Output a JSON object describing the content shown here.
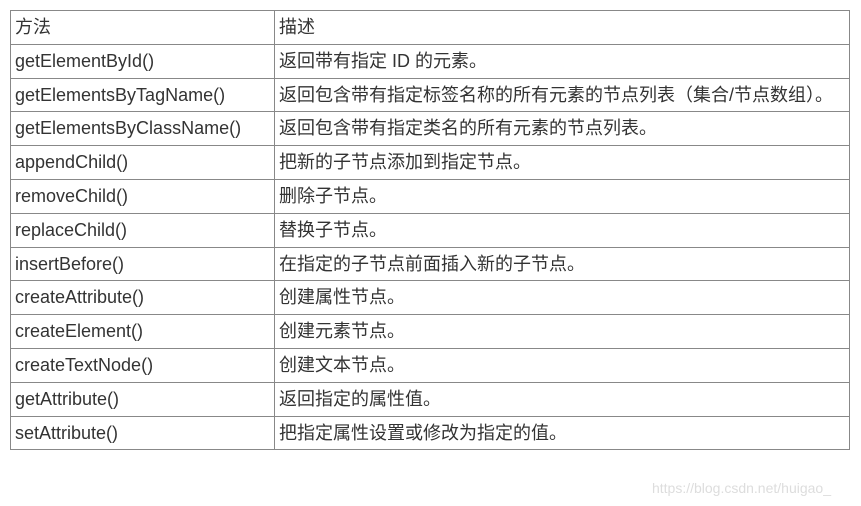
{
  "table": {
    "header": {
      "method": "方法",
      "desc": "描述"
    },
    "rows": [
      {
        "method": "getElementById()",
        "desc": "返回带有指定 ID 的元素。"
      },
      {
        "method": "getElementsByTagName()",
        "desc": "返回包含带有指定标签名称的所有元素的节点列表（集合/节点数组）。"
      },
      {
        "method": "getElementsByClassName()",
        "desc": "返回包含带有指定类名的所有元素的节点列表。"
      },
      {
        "method": "appendChild()",
        "desc": "把新的子节点添加到指定节点。"
      },
      {
        "method": "removeChild()",
        "desc": "删除子节点。"
      },
      {
        "method": "replaceChild()",
        "desc": "替换子节点。"
      },
      {
        "method": "insertBefore()",
        "desc": "在指定的子节点前面插入新的子节点。"
      },
      {
        "method": "createAttribute()",
        "desc": "创建属性节点。"
      },
      {
        "method": "createElement()",
        "desc": "创建元素节点。"
      },
      {
        "method": "createTextNode()",
        "desc": "创建文本节点。"
      },
      {
        "method": "getAttribute()",
        "desc": "返回指定的属性值。"
      },
      {
        "method": "setAttribute()",
        "desc": "把指定属性设置或修改为指定的值。"
      }
    ]
  },
  "watermark": "https://blog.csdn.net/huigao_"
}
